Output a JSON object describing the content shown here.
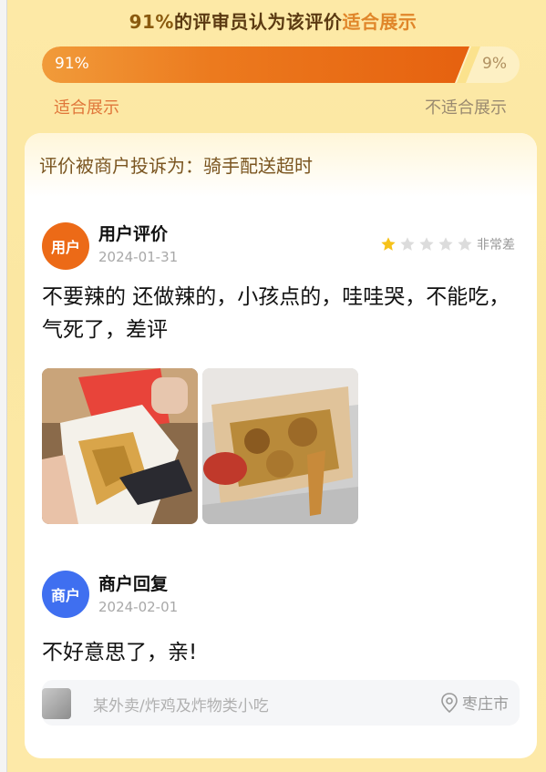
{
  "header": {
    "headline_pct": "91%",
    "headline_mid": "的评审员认为该评价",
    "headline_accent": "适合展示"
  },
  "vote": {
    "yes_fraction": 0.91,
    "yes_text": "91%",
    "no_text": "9%",
    "yes_label": "适合展示",
    "no_label": "不适合展示",
    "colors": {
      "yes": "#e6610f",
      "no": "#fdf0c4"
    }
  },
  "complaint": {
    "text": "评价被商户投诉为：骑手配送超时"
  },
  "review": {
    "avatar_text": "用户",
    "title": "用户评价",
    "date": "2024-01-31",
    "rating": 1,
    "rating_max": 5,
    "rating_text": "非常差",
    "text": "不要辣的 还做辣的，小孩点的，哇哇哭，不能吃，气死了，差评",
    "photos": [
      "food-photo-1",
      "food-photo-2"
    ]
  },
  "reply": {
    "avatar_text": "商户",
    "title": "商户回复",
    "date": "2024-02-01",
    "text": "不好意思了，亲!"
  },
  "store": {
    "name": "某外卖/炸鸡及炸物类小吃",
    "location": "枣庄市",
    "icons": [
      "store-thumbnail-icon",
      "location-pin-icon"
    ]
  }
}
